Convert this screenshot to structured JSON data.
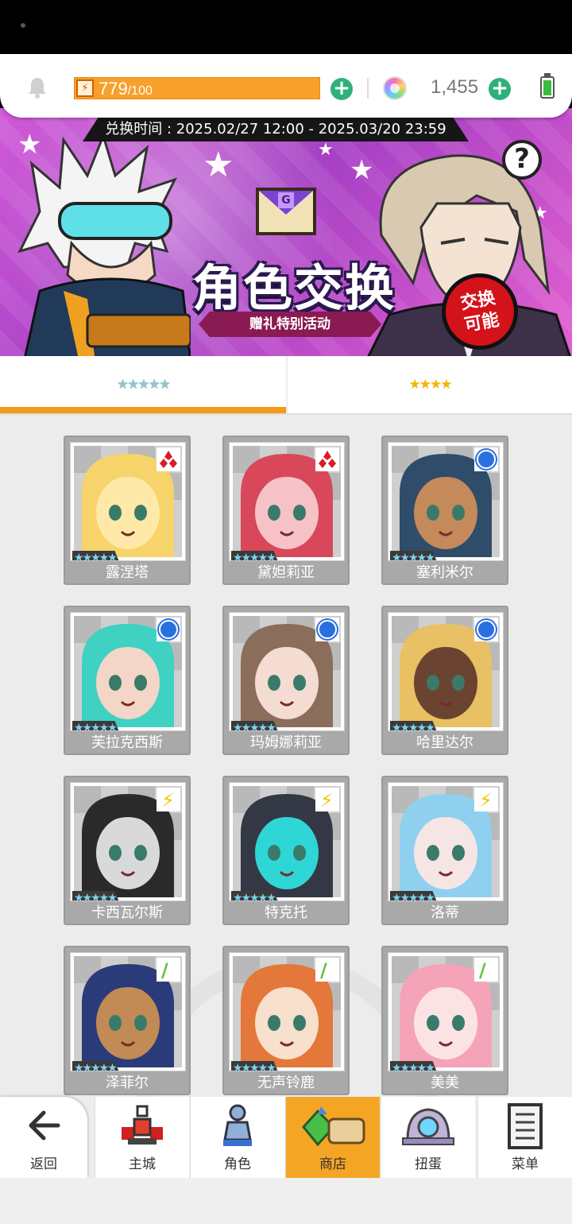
{
  "topbar": {
    "energy_value": "779",
    "energy_max": "/100",
    "gem_count": "1,455"
  },
  "banner": {
    "time_label": "兑换时间 : 2025.02/27 12:00 - 2025.03/20 23:59",
    "title": "角色交换",
    "subtitle": "赠礼特别活动",
    "badge_line1": "交换",
    "badge_line2": "可能",
    "help": "?",
    "mail_letter": "G"
  },
  "tabs": [
    {
      "label": "★★★★★",
      "active": true
    },
    {
      "label": "★★★★",
      "active": false
    }
  ],
  "characters": [
    {
      "name": "露涅塔",
      "stars": "★★★★★",
      "type": "red-diamond-icon"
    },
    {
      "name": "黛妲莉亚",
      "stars": "★★★★★",
      "type": "red-diamond-icon"
    },
    {
      "name": "塞利米尔",
      "stars": "★★★★★",
      "type": "blue-circle-icon"
    },
    {
      "name": "芙拉克西斯",
      "stars": "★★★★★",
      "type": "blue-circle-icon"
    },
    {
      "name": "玛姆娜莉亚",
      "stars": "★★★★★",
      "type": "blue-circle-icon"
    },
    {
      "name": "哈里达尔",
      "stars": "★★★★★",
      "type": "blue-circle-icon"
    },
    {
      "name": "卡西瓦尔斯",
      "stars": "★★★★★",
      "type": "lightning-icon"
    },
    {
      "name": "特克托",
      "stars": "★★★★★",
      "type": "lightning-icon"
    },
    {
      "name": "洛蒂",
      "stars": "★★★★★",
      "type": "lightning-icon"
    },
    {
      "name": "泽菲尔",
      "stars": "★★★★★",
      "type": "leaf-icon"
    },
    {
      "name": "无声铃鹿",
      "stars": "★★★★★",
      "type": "leaf-icon"
    },
    {
      "name": "美美",
      "stars": "★★★★★",
      "type": "leaf-icon"
    }
  ],
  "nav": {
    "back": "返回",
    "items": [
      {
        "label": "主城",
        "icon": "castle-icon"
      },
      {
        "label": "角色",
        "icon": "character-icon"
      },
      {
        "label": "商店",
        "icon": "shop-icon",
        "active": true
      },
      {
        "label": "扭蛋",
        "icon": "gacha-icon"
      },
      {
        "label": "菜单",
        "icon": "menu-icon"
      }
    ]
  },
  "colors": {
    "accent": "#f39a1c",
    "energy": "#f7a02c",
    "plus": "#2fb07a",
    "banner": "#c04fd0"
  }
}
